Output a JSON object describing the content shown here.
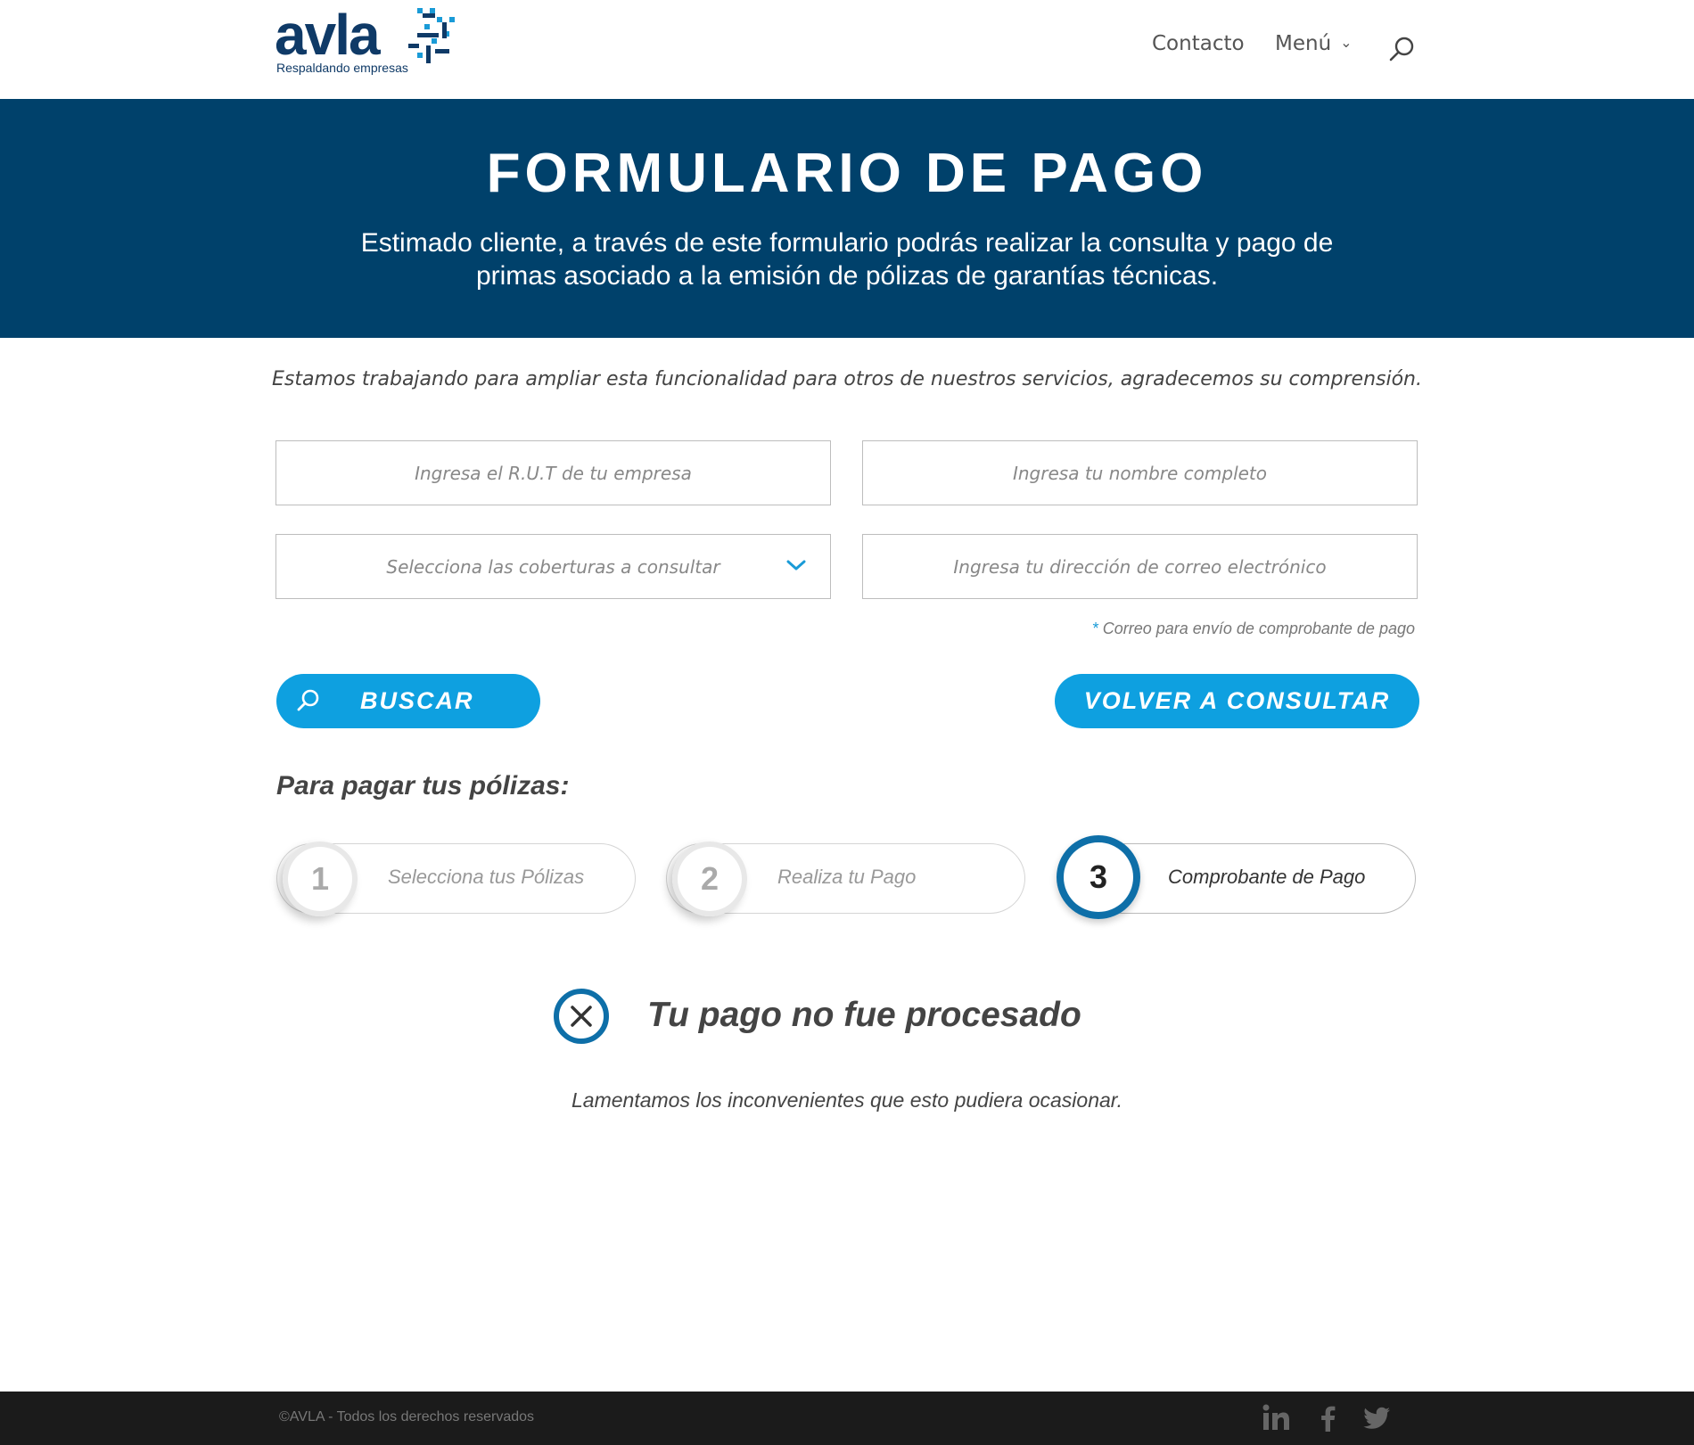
{
  "header": {
    "logo_word": "avla",
    "logo_tagline": "Respaldando empresas",
    "nav_contacto": "Contacto",
    "nav_menu": "Menú",
    "menu_icon": "chevron-down-icon",
    "search_icon": "search-icon"
  },
  "hero": {
    "title": "FORMULARIO DE PAGO",
    "subtitle": "Estimado cliente, a través de este formulario podrás realizar la consulta y pago de primas asociado a la emisión de pólizas de garantías técnicas."
  },
  "notice": "Estamos trabajando para ampliar esta funcionalidad para otros de nuestros servicios, agradecemos su comprensión.",
  "form": {
    "rut_placeholder": "Ingresa el R.U.T de tu empresa",
    "nombre_placeholder": "Ingresa tu nombre completo",
    "coberturas_placeholder": "Selecciona las coberturas a consultar",
    "correo_placeholder": "Ingresa tu dirección de correo electrónico",
    "hint_asterisk": "*",
    "hint": "Correo para envío de comprobante de pago",
    "buscar_label": "BUSCAR",
    "volver_label": "VOLVER A CONSULTAR"
  },
  "steps": {
    "title": "Para pagar tus pólizas:",
    "items": [
      {
        "num": "1",
        "label": "Selecciona tus Pólizas",
        "active": false
      },
      {
        "num": "2",
        "label": "Realiza tu Pago",
        "active": false
      },
      {
        "num": "3",
        "label": "Comprobante de Pago",
        "active": true
      }
    ]
  },
  "result": {
    "title": "Tu pago no fue procesado",
    "message": "Lamentamos los inconvenientes que esto pudiera ocasionar."
  },
  "footer": {
    "copyright": "©AVLA - Todos los derechos reservados",
    "social": [
      "linkedin-icon",
      "facebook-icon",
      "twitter-icon"
    ]
  },
  "colors": {
    "brand_navy": "#00416b",
    "accent_blue": "#0ea0e0",
    "footer_bg": "#1b1b1b"
  }
}
